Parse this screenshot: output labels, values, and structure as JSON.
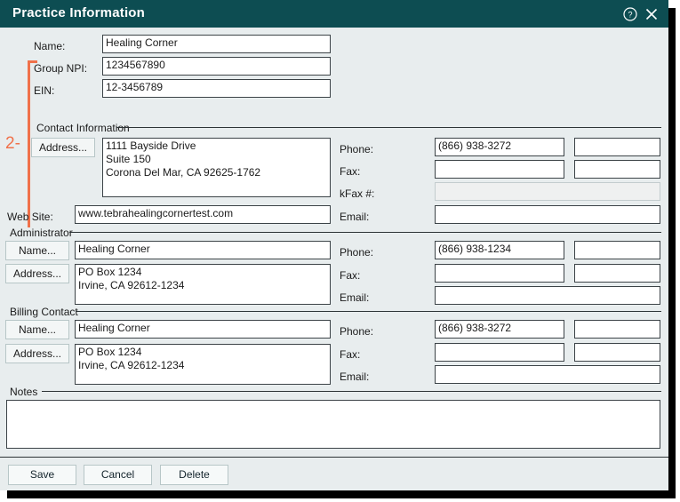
{
  "window": {
    "title": "Practice Information",
    "accent_teal": "#0d4d52",
    "background": "#e8edee",
    "annotation_color": "#f0714a"
  },
  "titlebar": {
    "help_icon": "help-circle-icon",
    "close_icon": "close-icon"
  },
  "annotation": {
    "number": "2-"
  },
  "identity": {
    "name_label": "Name:",
    "name_value": "Healing Corner",
    "group_npi_label": "Group NPI:",
    "group_npi_value": "1234567890",
    "ein_label": "EIN:",
    "ein_value": "12-3456789"
  },
  "contact": {
    "group_title": "Contact Information",
    "address_button": "Address...",
    "address_value": "1111 Bayside Drive\nSuite 150\nCorona Del Mar, CA 92625-1762",
    "phone_label": "Phone:",
    "phone_value": "(866) 938-3272",
    "phone_ext_value": "",
    "fax_label": "Fax:",
    "fax_value": "",
    "fax_ext_value": "",
    "kfax_label": "kFax #:",
    "kfax_value": "",
    "email_label": "Email:",
    "email_value": ""
  },
  "website": {
    "label": "Web Site:",
    "value": "www.tebrahealingcornertest.com"
  },
  "administrator": {
    "group_title": "Administrator",
    "name_button": "Name...",
    "name_value": "Healing Corner",
    "address_button": "Address...",
    "address_value": "PO Box 1234\nIrvine, CA 92612-1234",
    "phone_label": "Phone:",
    "phone_value": "(866) 938-1234",
    "phone_ext_value": "",
    "fax_label": "Fax:",
    "fax_value": "",
    "fax_ext_value": "",
    "email_label": "Email:",
    "email_value": ""
  },
  "billing": {
    "group_title": "Billing Contact",
    "name_button": "Name...",
    "name_value": "Healing Corner",
    "address_button": "Address...",
    "address_value": "PO Box 1234\nIrvine, CA 92612-1234",
    "phone_label": "Phone:",
    "phone_value": "(866) 938-3272",
    "phone_ext_value": "",
    "fax_label": "Fax:",
    "fax_value": "",
    "fax_ext_value": "",
    "email_label": "Email:",
    "email_value": ""
  },
  "notes": {
    "group_title": "Notes",
    "value": ""
  },
  "actions": {
    "save": "Save",
    "cancel": "Cancel",
    "delete": "Delete"
  }
}
